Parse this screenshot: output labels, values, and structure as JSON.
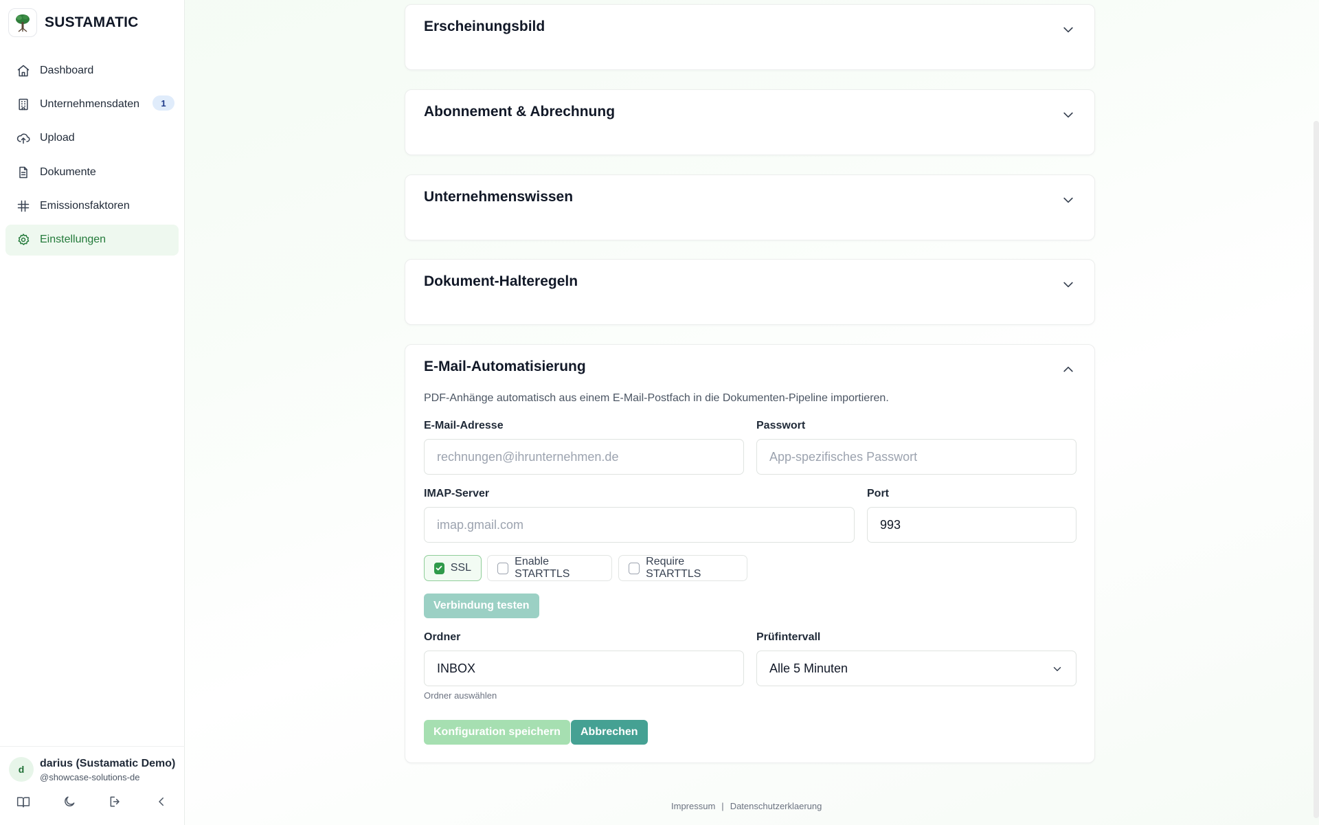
{
  "brand": {
    "name": "SUSTAMATIC"
  },
  "sidebar": {
    "items": [
      {
        "label": "Dashboard",
        "icon": "home-icon"
      },
      {
        "label": "Unternehmensdaten",
        "icon": "building-icon",
        "badge": "1"
      },
      {
        "label": "Upload",
        "icon": "upload-cloud-icon"
      },
      {
        "label": "Dokumente",
        "icon": "document-icon"
      },
      {
        "label": "Emissionsfaktoren",
        "icon": "hash-icon"
      },
      {
        "label": "Einstellungen",
        "icon": "gear-icon",
        "active": true
      }
    ]
  },
  "user": {
    "initial": "d",
    "name": "darius (Sustamatic Demo)",
    "handle": "@showcase-solutions-de"
  },
  "sections": {
    "appearance": "Erscheinungsbild",
    "subscription": "Abonnement & Abrechnung",
    "knowledge": "Unternehmenswissen",
    "retention": "Dokument-Halteregeln",
    "email": "E-Mail-Automatisierung"
  },
  "email_form": {
    "description": "PDF-Anhänge automatisch aus einem E-Mail-Postfach in die Dokumenten-Pipeline importieren.",
    "email_label": "E-Mail-Adresse",
    "email_placeholder": "rechnungen@ihrunternehmen.de",
    "password_label": "Passwort",
    "password_placeholder": "App-spezifisches Passwort",
    "imap_label": "IMAP-Server",
    "imap_placeholder": "imap.gmail.com",
    "port_label": "Port",
    "port_value": "993",
    "ssl_label": "SSL",
    "ssl_checked": true,
    "enable_starttls_label": "Enable STARTTLS",
    "enable_starttls_checked": false,
    "require_starttls_label": "Require STARTTLS",
    "require_starttls_checked": false,
    "test_button": "Verbindung testen",
    "folder_label": "Ordner",
    "folder_value": "INBOX",
    "folder_hint": "Ordner auswählen",
    "interval_label": "Prüfintervall",
    "interval_value": "Alle 5 Minuten",
    "save_button": "Konfiguration speichern",
    "cancel_button": "Abbrechen"
  },
  "footer": {
    "imprint": "Impressum",
    "separator": "|",
    "privacy": "Datenschutzerklaerung"
  },
  "colors": {
    "accent_green": "#2f9a4a",
    "active_nav_bg": "#eef8ef",
    "teal_button": "#45a193"
  }
}
